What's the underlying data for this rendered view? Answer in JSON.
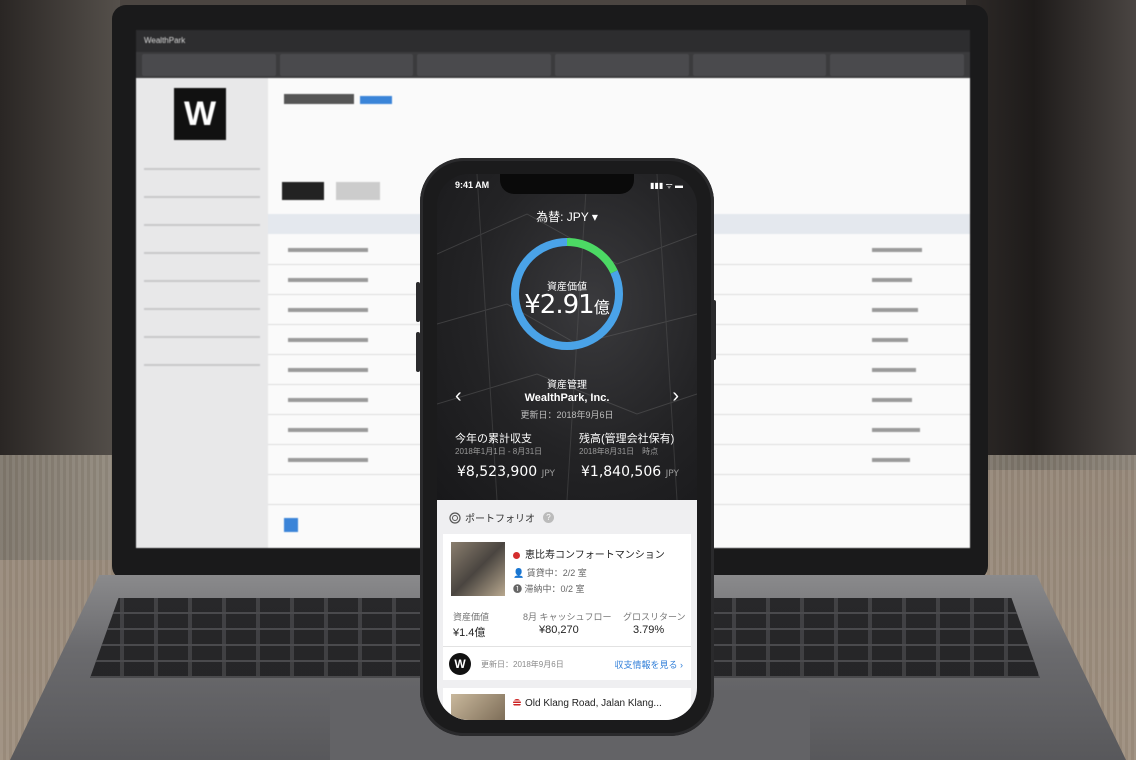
{
  "laptop": {
    "app_title": "WealthPark",
    "logo_letter": "W"
  },
  "phone": {
    "status": {
      "time": "9:41 AM",
      "icons": "▮▮▮ ᯤ ▬"
    },
    "currency_selector": "為替: JPY",
    "asset_ring": {
      "label": "資産価値",
      "value": "¥2.91",
      "unit": "億",
      "segments": [
        {
          "color": "#4cd964",
          "fraction": 0.18
        },
        {
          "color": "#4aa3e8",
          "fraction": 0.82
        }
      ]
    },
    "management": {
      "label": "資産管理",
      "company": "WealthPark, Inc.",
      "updated": "更新日：2018年9月6日",
      "prev_icon": "chevron-left",
      "next_icon": "chevron-right"
    },
    "stats": [
      {
        "title": "今年の累計収支",
        "period": "2018年1月1日 - 8月31日",
        "value": "¥8,523,900",
        "currency": "JPY"
      },
      {
        "title": "残高(管理会社保有)",
        "period": "2018年8月31日　時点",
        "value": "¥1,840,506",
        "currency": "JPY"
      }
    ],
    "portfolio": {
      "header": "ポートフォリオ",
      "help": "?",
      "properties": [
        {
          "name": "恵比寿コンフォートマンション",
          "rented": "賃貸中：2/2 室",
          "arrears": "滞納中：0/2 室",
          "metrics": [
            {
              "label": "資産価値",
              "value": "¥1.4億"
            },
            {
              "label": "8月 キャッシュフロー",
              "value": "¥80,270"
            },
            {
              "label": "グロスリターン",
              "value": "3.79%"
            }
          ],
          "badge": "W",
          "updated": "更新日：2018年9月6日",
          "link": "収支情報を見る"
        },
        {
          "name": "Old Klang Road, Jalan Klang..."
        }
      ]
    }
  }
}
